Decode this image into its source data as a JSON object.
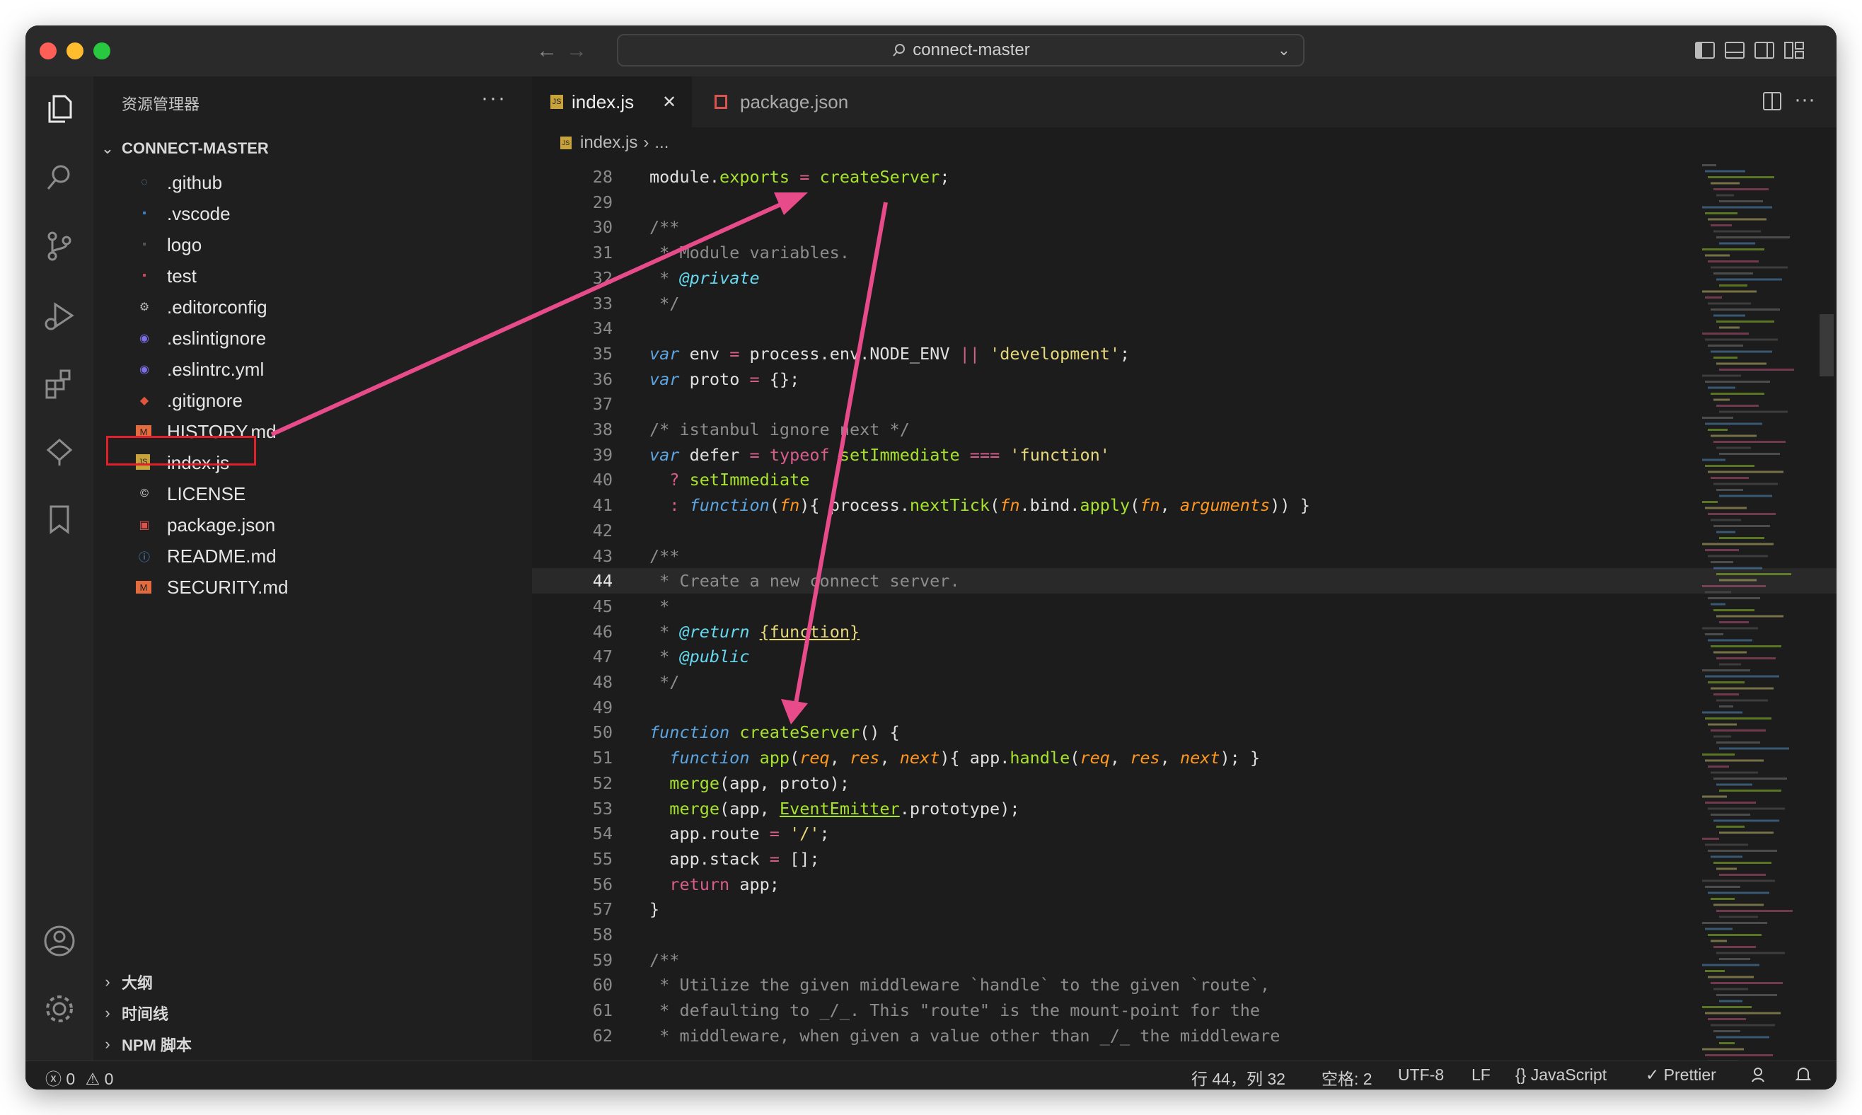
{
  "window": {
    "title": "connect-master",
    "colors": {
      "close": "#ff5f57",
      "minimize": "#febc2e",
      "maximize": "#28c840",
      "accent_annotation": "#e84b8a",
      "selection_box": "#e0202a"
    }
  },
  "sidebar": {
    "title": "资源管理器",
    "more": "···",
    "root": "CONNECT-MASTER",
    "files": [
      {
        "name": ".github",
        "icon": "folder-github-icon"
      },
      {
        "name": ".vscode",
        "icon": "folder-vscode-icon"
      },
      {
        "name": "logo",
        "icon": "folder-icon"
      },
      {
        "name": "test",
        "icon": "folder-test-icon"
      },
      {
        "name": ".editorconfig",
        "icon": "gear-icon"
      },
      {
        "name": ".eslintignore",
        "icon": "eslint-icon"
      },
      {
        "name": ".eslintrc.yml",
        "icon": "eslint-icon"
      },
      {
        "name": ".gitignore",
        "icon": "git-icon"
      },
      {
        "name": "HISTORY.md",
        "icon": "markdown-icon"
      },
      {
        "name": "index.js",
        "icon": "js-icon"
      },
      {
        "name": "LICENSE",
        "icon": "license-icon"
      },
      {
        "name": "package.json",
        "icon": "npm-icon"
      },
      {
        "name": "README.md",
        "icon": "info-icon"
      },
      {
        "name": "SECURITY.md",
        "icon": "markdown-icon"
      }
    ],
    "sections": [
      "大纲",
      "时间线",
      "NPM 脚本"
    ]
  },
  "tabs": [
    {
      "label": "index.js",
      "icon": "js-icon",
      "active": true,
      "close": "✕"
    },
    {
      "label": "package.json",
      "icon": "npm-icon",
      "active": false
    }
  ],
  "breadcrumb": {
    "file": "index.js",
    "sep": "›",
    "rest": "..."
  },
  "code": {
    "lines": [
      {
        "n": "28",
        "html": "module.<span class='prop'>exports</span> <span class='kw'>=</span> <span class='fn'>createServer</span>;"
      },
      {
        "n": "29",
        "html": ""
      },
      {
        "n": "30",
        "html": "<span class='cm'>/**</span>"
      },
      {
        "n": "31",
        "html": "<span class='cm'> * Module variables.</span>"
      },
      {
        "n": "32",
        "html": "<span class='cm'> * </span><span class='doc'>@private</span>"
      },
      {
        "n": "33",
        "html": "<span class='cm'> */</span>"
      },
      {
        "n": "34",
        "html": ""
      },
      {
        "n": "35",
        "html": "<span class='k'>var</span> env <span class='kw'>=</span> process.env.NODE_ENV <span class='kw'>||</span> <span class='str'>'development'</span>;"
      },
      {
        "n": "36",
        "html": "<span class='k'>var</span> proto <span class='kw'>=</span> {};"
      },
      {
        "n": "37",
        "html": ""
      },
      {
        "n": "38",
        "html": "<span class='cm'>/* istanbul ignore next */</span>"
      },
      {
        "n": "39",
        "html": "<span class='k'>var</span> defer <span class='kw'>=</span> <span class='kw'>typeof</span> <span class='fn'>setImmediate</span> <span class='kw'>===</span> <span class='str'>'function'</span>"
      },
      {
        "n": "40",
        "html": "  <span class='kw'>?</span> <span class='fn'>setImmediate</span>"
      },
      {
        "n": "41",
        "html": "  <span class='kw'>:</span> <span class='k'>function</span>(<span class='par'>fn</span>){ process.<span class='fn'>nextTick</span>(<span class='par'>fn</span>.bind.<span class='fn'>apply</span>(<span class='par'>fn</span>, <span class='par'>arguments</span>)) }"
      },
      {
        "n": "42",
        "html": ""
      },
      {
        "n": "43",
        "html": "<span class='cm'>/**</span>"
      },
      {
        "n": "44",
        "html": "<span class='cm'> * Create a new connect server.</span>",
        "current": true
      },
      {
        "n": "45",
        "html": "<span class='cm'> *</span>"
      },
      {
        "n": "46",
        "html": "<span class='cm'> * </span><span class='doc'>@return</span> <span class='cls' style='color:#e6d77a'>{function}</span>"
      },
      {
        "n": "47",
        "html": "<span class='cm'> * </span><span class='doc'>@public</span>"
      },
      {
        "n": "48",
        "html": "<span class='cm'> */</span>"
      },
      {
        "n": "49",
        "html": ""
      },
      {
        "n": "50",
        "html": "<span class='k'>function</span> <span class='fn'>createServer</span>() {"
      },
      {
        "n": "51",
        "html": "  <span class='k'>function</span> <span class='fn'>app</span>(<span class='par'>req</span>, <span class='par'>res</span>, <span class='par'>next</span>){ app.<span class='fn'>handle</span>(<span class='par'>req</span>, <span class='par'>res</span>, <span class='par'>next</span>); }"
      },
      {
        "n": "52",
        "html": "  <span class='fn'>merge</span>(app, proto);"
      },
      {
        "n": "53",
        "html": "  <span class='fn'>merge</span>(app, <span class='cls'>EventEmitter</span>.prototype);"
      },
      {
        "n": "54",
        "html": "  app.route <span class='kw'>=</span> <span class='str'>'/'</span>;"
      },
      {
        "n": "55",
        "html": "  app.stack <span class='kw'>=</span> [];"
      },
      {
        "n": "56",
        "html": "  <span class='kw'>return</span> app;"
      },
      {
        "n": "57",
        "html": "}"
      },
      {
        "n": "58",
        "html": ""
      },
      {
        "n": "59",
        "html": "<span class='cm'>/**</span>"
      },
      {
        "n": "60",
        "html": "<span class='cm'> * Utilize the given middleware `handle` to the given `route`,</span>"
      },
      {
        "n": "61",
        "html": "<span class='cm'> * defaulting to _/_. This \"route\" is the mount-point for the</span>"
      },
      {
        "n": "62",
        "html": "<span class='cm'> * middleware, when given a value other than _/_ the middleware</span>"
      }
    ]
  },
  "statusbar": {
    "errors": "0",
    "warnings": "0",
    "position": "行 44，列 32",
    "indent": "空格: 2",
    "encoding": "UTF-8",
    "eol": "LF",
    "language": "JavaScript",
    "formatter": "Prettier"
  }
}
